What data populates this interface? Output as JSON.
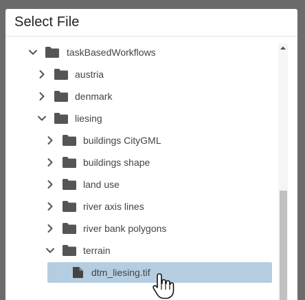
{
  "dialog": {
    "title": "Select File"
  },
  "tree": {
    "items": [
      {
        "label": "taskBasedWorkflows",
        "type": "folder",
        "expanded": true,
        "depth": 0
      },
      {
        "label": "austria",
        "type": "folder",
        "expanded": false,
        "depth": 1
      },
      {
        "label": "denmark",
        "type": "folder",
        "expanded": false,
        "depth": 1
      },
      {
        "label": "liesing",
        "type": "folder",
        "expanded": true,
        "depth": 1
      },
      {
        "label": "buildings CityGML",
        "type": "folder",
        "expanded": false,
        "depth": 2
      },
      {
        "label": "buildings shape",
        "type": "folder",
        "expanded": false,
        "depth": 2
      },
      {
        "label": "land use",
        "type": "folder",
        "expanded": false,
        "depth": 2
      },
      {
        "label": "river axis lines",
        "type": "folder",
        "expanded": false,
        "depth": 2
      },
      {
        "label": "river bank polygons",
        "type": "folder",
        "expanded": false,
        "depth": 2
      },
      {
        "label": "terrain",
        "type": "folder",
        "expanded": true,
        "depth": 2
      },
      {
        "label": "dtm_liesing.tif",
        "type": "file",
        "selected": true,
        "depth": 3
      }
    ]
  },
  "icons": {
    "expanded": "chevron-down-icon",
    "collapsed": "chevron-right-icon",
    "folder": "folder-icon",
    "file": "file-icon",
    "cursor": "hand-pointer-icon"
  },
  "colors": {
    "backdrop": "#6b6b6b",
    "selected_row": "#b5cde0",
    "icon": "#555555",
    "text": "#444444"
  }
}
